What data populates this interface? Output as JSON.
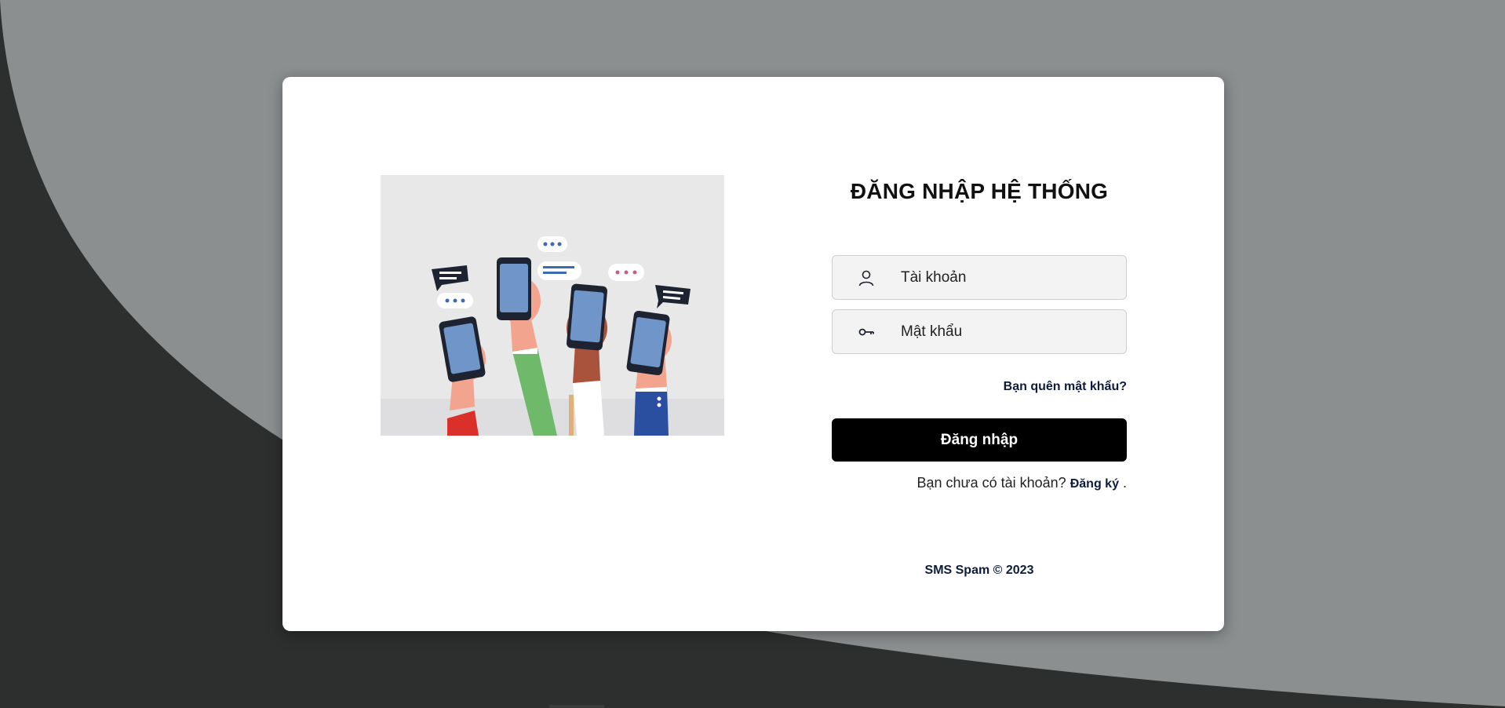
{
  "colors": {
    "background_light": "#8b8f90",
    "background_dark": "#2d2f2e",
    "card": "#ffffff",
    "button": "#000000",
    "link": "#0d1b3d"
  },
  "login": {
    "title": "ĐĂNG NHẬP HỆ THỐNG",
    "username_placeholder": "Tài khoản",
    "username_icon": "user-icon",
    "password_placeholder": "Mật khẩu",
    "password_icon": "key-icon",
    "forgot_link": "Bạn quên mật khẩu?",
    "submit_label": "Đăng nhập",
    "signup_prompt": "Bạn chưa có tài khoản?",
    "signup_link": "Đăng ký",
    "signup_suffix": "."
  },
  "footer": {
    "text": "SMS Spam © 2023"
  }
}
